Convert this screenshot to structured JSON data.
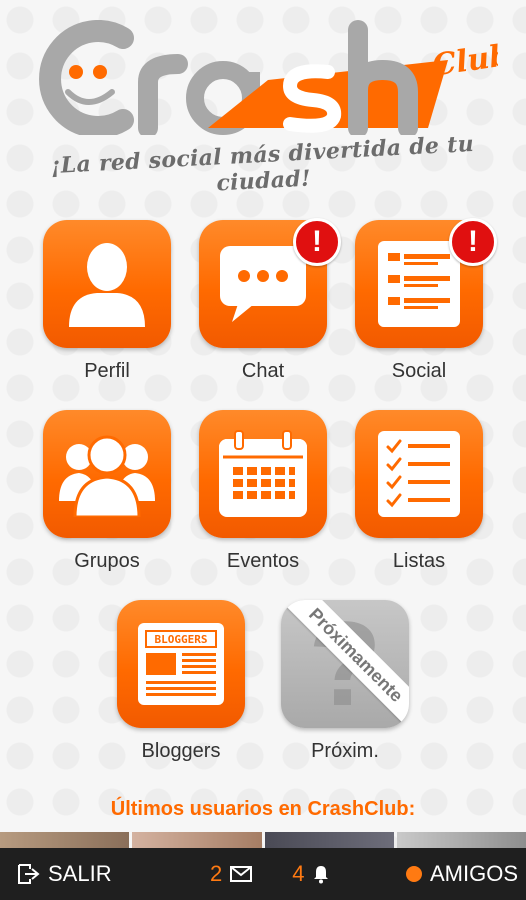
{
  "brand": {
    "logo_text": "Crash",
    "logo_sub": "Club",
    "tagline": "¡La red social más divertida de tu ciudad!"
  },
  "colors": {
    "accent": "#ff6a00",
    "grey": "#a9a9a9",
    "badge": "#e01010",
    "bar": "#1f1f1f"
  },
  "tiles": [
    {
      "label": "Perfil",
      "icon": "person-icon",
      "badge": ""
    },
    {
      "label": "Chat",
      "icon": "chat-bubble-icon",
      "badge": "!"
    },
    {
      "label": "Social",
      "icon": "news-feed-icon",
      "badge": "!"
    },
    {
      "label": "Grupos",
      "icon": "group-icon",
      "badge": ""
    },
    {
      "label": "Eventos",
      "icon": "calendar-icon",
      "badge": ""
    },
    {
      "label": "Listas",
      "icon": "checklist-icon",
      "badge": ""
    },
    {
      "label": "Bloggers",
      "icon": "newspaper-icon",
      "badge": "",
      "icon_text": "BLOGGERS"
    },
    {
      "label": "Próxim.",
      "icon": "question-mark-icon",
      "badge": "",
      "ribbon": "Próximamente"
    }
  ],
  "recent_users_title": "Últimos usuarios en CrashClub:",
  "bottom_bar": {
    "logout_label": "SALIR",
    "logout_icon": "logout-icon",
    "messages_count": "2",
    "messages_icon": "envelope-icon",
    "notifications_count": "4",
    "notifications_icon": "bell-icon",
    "friends_label": "AMIGOS",
    "friends_icon": "online-dot-icon"
  }
}
